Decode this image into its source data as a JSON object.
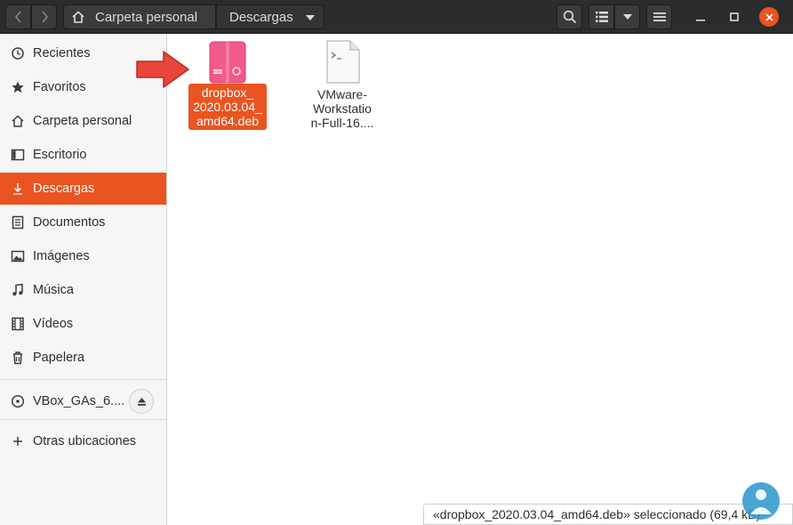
{
  "header": {
    "back_icon": "chevron-left-icon",
    "forward_icon": "chevron-right-icon",
    "breadcrumb_home": "Carpeta personal",
    "breadcrumb_current": "Descargas",
    "search_icon": "search-icon",
    "view_icon": "list-view-icon",
    "menu_icon": "hamburger-menu-icon"
  },
  "sidebar": {
    "items": [
      {
        "label": "Recientes",
        "icon": "clock-icon"
      },
      {
        "label": "Favoritos",
        "icon": "star-icon"
      },
      {
        "label": "Carpeta personal",
        "icon": "home-icon"
      },
      {
        "label": "Escritorio",
        "icon": "desktop-icon"
      },
      {
        "label": "Descargas",
        "icon": "download-icon",
        "active": true
      },
      {
        "label": "Documentos",
        "icon": "document-icon"
      },
      {
        "label": "Imágenes",
        "icon": "image-icon"
      },
      {
        "label": "Música",
        "icon": "music-icon"
      },
      {
        "label": "Vídeos",
        "icon": "video-icon"
      },
      {
        "label": "Papelera",
        "icon": "trash-icon"
      }
    ],
    "device": {
      "label": "VBox_GAs_6....",
      "icon": "disc-icon",
      "eject_icon": "eject-icon"
    },
    "other": {
      "label": "Otras ubicaciones",
      "icon": "plus-icon"
    }
  },
  "files": [
    {
      "name_lines": [
        "dropbox_",
        "2020.03.04_",
        "amd64.deb"
      ],
      "icon": "deb-package-icon",
      "selected": true
    },
    {
      "name_lines": [
        "VMware-",
        "Workstatio",
        "n-Full-16...."
      ],
      "icon": "script-file-icon",
      "selected": false
    }
  ],
  "status": "«dropbox_2020.03.04_amd64.deb» seleccionado  (69,4 kB)",
  "colors": {
    "accent": "#e95420",
    "header_bg": "#2c2c2c",
    "sidebar_bg": "#f6f6f5"
  }
}
